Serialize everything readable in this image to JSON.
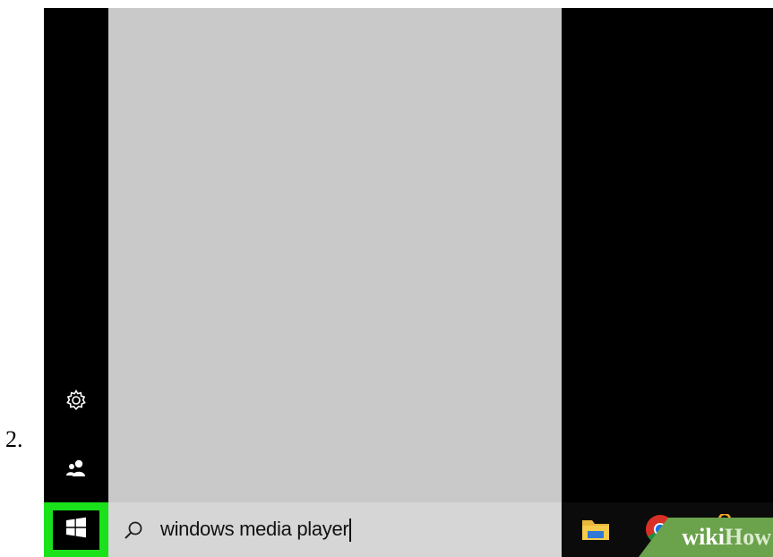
{
  "step": {
    "number": "2."
  },
  "rail": {
    "icons": [
      "gear-icon",
      "user-icon"
    ]
  },
  "taskbar": {
    "start_icon": "windows-logo-icon",
    "search": {
      "icon": "search-icon",
      "value": "windows media player"
    },
    "pinned_icons": [
      "file-explorer-icon",
      "chrome-icon",
      "store-icon"
    ]
  },
  "watermark": {
    "part1": "wiki",
    "part2": "How"
  },
  "colors": {
    "start_highlight": "#1ae21a",
    "panel": "#c9c9c9",
    "search_box": "#d6d6d6",
    "background": "#000000",
    "watermark": "#6ba24c"
  }
}
